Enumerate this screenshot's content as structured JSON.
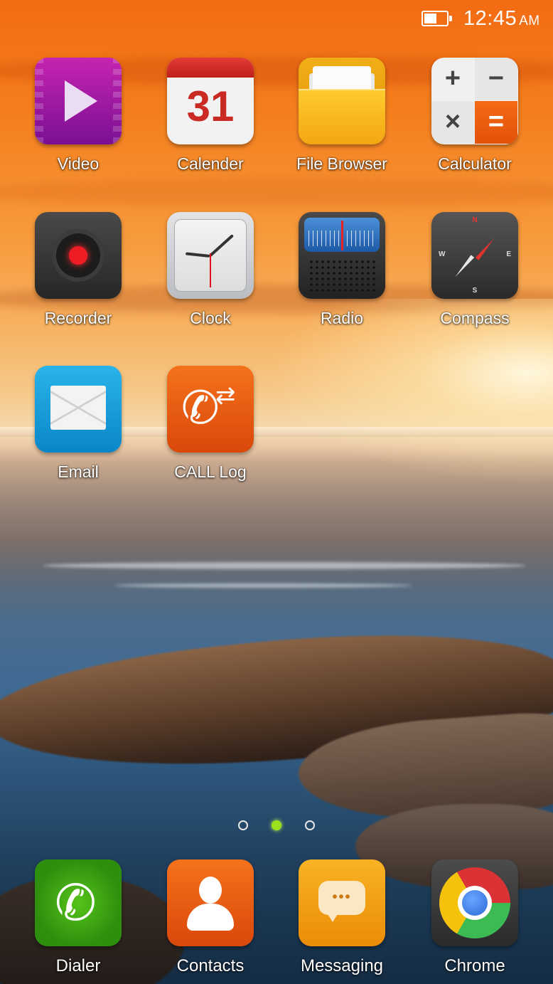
{
  "status_bar": {
    "time": "12:45",
    "ampm": "AM",
    "battery_level": 0.55
  },
  "apps": [
    {
      "label": "Video",
      "icon": "video-icon"
    },
    {
      "label": "Calender",
      "icon": "calendar-icon",
      "icon_text": "31"
    },
    {
      "label": "File Browser",
      "icon": "folder-icon"
    },
    {
      "label": "Calculator",
      "icon": "calculator-icon",
      "icon_text": [
        "+",
        "−",
        "×",
        "="
      ]
    },
    {
      "label": "Recorder",
      "icon": "recorder-icon"
    },
    {
      "label": "Clock",
      "icon": "clock-icon"
    },
    {
      "label": "Radio",
      "icon": "radio-icon"
    },
    {
      "label": "Compass",
      "icon": "compass-icon",
      "icon_text": [
        "N",
        "S",
        "W",
        "E"
      ]
    },
    {
      "label": "Email",
      "icon": "envelope-icon"
    },
    {
      "label": "CALL Log",
      "icon": "call-log-icon"
    }
  ],
  "page_indicator": {
    "pages": 3,
    "active_page": 2
  },
  "dock": [
    {
      "label": "Dialer",
      "icon": "phone-icon"
    },
    {
      "label": "Contacts",
      "icon": "contact-person-icon"
    },
    {
      "label": "Messaging",
      "icon": "chat-bubble-icon"
    },
    {
      "label": "Chrome",
      "icon": "chrome-icon"
    }
  ],
  "colors": {
    "accent_active_dot": "#9be21d"
  }
}
